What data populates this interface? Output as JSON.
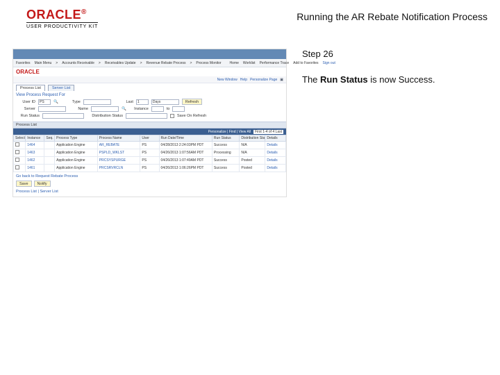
{
  "header": {
    "logo_text": "ORACLE",
    "logo_sub": "USER PRODUCTIVITY KIT",
    "title": "Running the AR Rebate Notification Process"
  },
  "instructions": {
    "step": "Step 26",
    "desc_pre": "The ",
    "desc_bold": "Run Status",
    "desc_post": " is now Success."
  },
  "shot": {
    "nav": {
      "left": "Favorites",
      "main_menu": "Main Menu",
      "crumb1": "Accounts Receivable",
      "crumb2": "Receivables Update",
      "crumb3": "Revenue Rebate Process",
      "crumb4": "Process Monitor",
      "home": "Home",
      "worklist": "Worklist",
      "perf": "Performance Trace",
      "addfav": "Add to Favorites",
      "signout": "Sign out"
    },
    "brand": "ORACLE",
    "subbar": {
      "new": "New Window",
      "help": "Help",
      "pers": "Personalize Page"
    },
    "tabs": {
      "t1": "Process List",
      "t2": "Server List"
    },
    "section_req": "View Process Request For",
    "form": {
      "user_lbl": "User ID",
      "user_val": "PS",
      "type_lbl": "Type",
      "type_val": "",
      "last_lbl": "Last",
      "last_val": "1",
      "unit_val": "Days",
      "refresh": "Refresh",
      "server_lbl": "Server",
      "server_val": "",
      "name_lbl": "Name",
      "name_val": "",
      "inst_lbl": "Instance",
      "to_lbl": "to",
      "runstat_lbl": "Run Status",
      "runstat_val": "",
      "diststat_lbl": "Distribution Status",
      "diststat_val": "",
      "saveon": "Save On Refresh"
    },
    "list": {
      "title": "Process List",
      "toolbar_view": "Personalize | Find | View All",
      "toolbar_page": "First 1-4 of 4 Last",
      "cols": {
        "select": "Select",
        "instance": "Instance",
        "seq": "Seq.",
        "ptype": "Process Type",
        "pname": "Process Name",
        "user": "User",
        "rundate": "Run Date/Time",
        "rstatus": "Run Status",
        "dstatus": "Distribution Status",
        "details": "Details"
      },
      "rows": [
        {
          "inst": "1464",
          "seq": "",
          "ptype": "Application Engine",
          "pname": "AR_REBATE",
          "user": "PS",
          "date": "04/28/2013 2:24:03PM PDT",
          "rstat": "Success",
          "dstat": "N/A",
          "det": "Details"
        },
        {
          "inst": "1463",
          "seq": "",
          "ptype": "Application Engine",
          "pname": "PSPLD_WKLST",
          "user": "PS",
          "date": "04/26/2013 1:07:56AM PDT",
          "rstat": "Processing",
          "dstat": "N/A",
          "det": "Details"
        },
        {
          "inst": "1462",
          "seq": "",
          "ptype": "Application Engine",
          "pname": "PRCSYSPURGE",
          "user": "PS",
          "date": "04/26/2013 1:07:49AM PDT",
          "rstat": "Success",
          "dstat": "Posted",
          "det": "Details"
        },
        {
          "inst": "1461",
          "seq": "",
          "ptype": "Application Engine",
          "pname": "PRCSRVRCLN",
          "user": "PS",
          "date": "04/26/2013 1:06:26PM PDT",
          "rstat": "Success",
          "dstat": "Posted",
          "det": "Details"
        }
      ]
    },
    "sched": "Go back to Request Rebate Process",
    "btn_save": "Save",
    "btn_notify": "Notify",
    "bottom_link": "Process List | Server List"
  }
}
